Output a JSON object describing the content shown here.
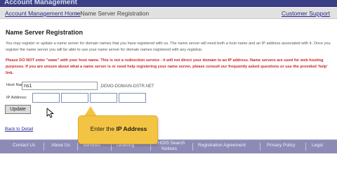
{
  "header": {
    "app_title": "Account Management"
  },
  "breadcrumb": {
    "home_link": "Account Management Home",
    "separator": ">",
    "current": "Name Server Registration",
    "support_link": "Customer Support"
  },
  "main": {
    "title": "Name Server Registration",
    "intro": "You may register or update a name server for domain names that you have registered with us. The name server will need both a host name and an IP address associated with it. Once you register the name server you will be able to use your name server for domain names registered with any registrar.",
    "warning": "Please DO NOT enter \"www\" with your host name. This is not a redirection service - it will not direct your domain to an IP address. Name servers are used for web hosting purposes. If you are unsure about what a name server is or need help registering your name server, please consult our frequently asked questions or use the provided 'help' link."
  },
  "form": {
    "host_label": "Host Name:",
    "host_value": "ns1",
    "domain_suffix": ".DEMO-DOMAIN-DSTR.NET",
    "ip_label": "IP Address:",
    "ip_octets": [
      "",
      "",
      "",
      ""
    ],
    "update_button": "Update"
  },
  "back_link": "Back to Detail",
  "footer": {
    "links": [
      "Contact Us",
      "About Us",
      "Services",
      "Ordering",
      "WHOIS Search",
      "Notices",
      "Registration Agreement",
      "Privacy Policy",
      "Legal"
    ]
  },
  "tooltip": {
    "prefix": "Enter the ",
    "emphasis": "IP Address"
  },
  "colors": {
    "header_bg": "#3a3f86",
    "footer_bg": "#8d8bb6",
    "warning_text": "#c8262a",
    "link_text": "#2a2a8f",
    "tooltip_bg": "#f3c444"
  }
}
